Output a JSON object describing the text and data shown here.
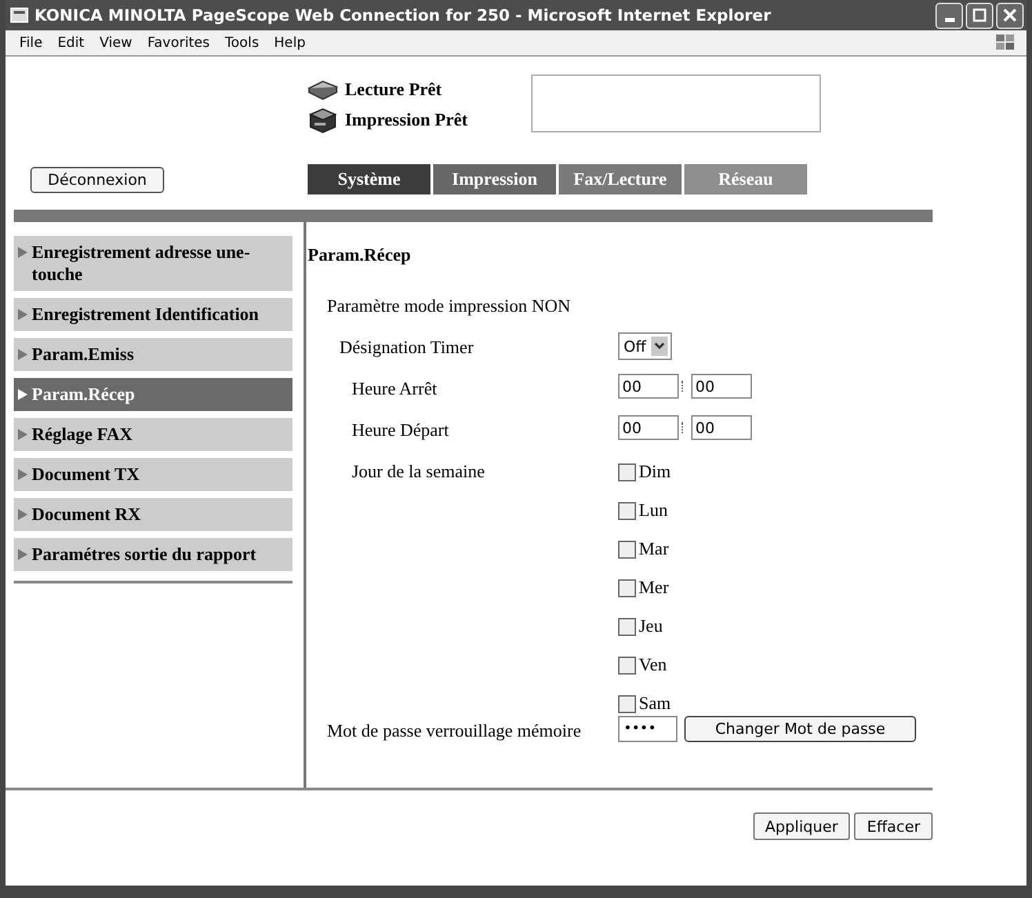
{
  "window": {
    "title": "KONICA MINOLTA PageScope Web Connection for 250 - Microsoft Internet Explorer"
  },
  "menu": [
    "File",
    "Edit",
    "View",
    "Favorites",
    "Tools",
    "Help"
  ],
  "status": [
    {
      "kind": "scanner",
      "label": "Lecture Prêt"
    },
    {
      "kind": "printer",
      "label": "Impression Prêt"
    }
  ],
  "logout_button": "Déconnexion",
  "tabs": [
    {
      "label": "Système",
      "selected": true
    },
    {
      "label": "Impression",
      "selected": false
    },
    {
      "label": "Fax/Lecture",
      "selected": false
    },
    {
      "label": "Réseau",
      "selected": false
    }
  ],
  "sidebar": {
    "items": [
      {
        "label": "Enregistrement adresse une-touche",
        "selected": false
      },
      {
        "label": "Enregistrement Identification",
        "selected": false
      },
      {
        "label": "Param.Emiss",
        "selected": false
      },
      {
        "label": "Param.Récep",
        "selected": true
      },
      {
        "label": "Réglage FAX",
        "selected": false
      },
      {
        "label": "Document TX",
        "selected": false
      },
      {
        "label": "Document RX",
        "selected": false
      },
      {
        "label": "Paramétres sortie du rapport",
        "selected": false
      }
    ]
  },
  "form": {
    "title": "Param.Récep",
    "rows": [
      {
        "kind": "heading",
        "label": "Paramètre mode impression NON",
        "children": [
          {
            "kind": "select",
            "label": "Désignation Timer",
            "value": "Off",
            "children": [
              {
                "kind": "time",
                "label": "Heure Arrêt",
                "hour": "00",
                "minute": "00"
              },
              {
                "kind": "time",
                "label": "Heure Départ",
                "hour": "00",
                "minute": "00"
              },
              {
                "kind": "days",
                "label": "Jour de la semaine",
                "days": [
                  {
                    "label": "Dim",
                    "checked": false
                  },
                  {
                    "label": "Lun",
                    "checked": false
                  },
                  {
                    "label": "Mar",
                    "checked": false
                  },
                  {
                    "label": "Mer",
                    "checked": false
                  },
                  {
                    "label": "Jeu",
                    "checked": false
                  },
                  {
                    "label": "Ven",
                    "checked": false
                  },
                  {
                    "label": "Sam",
                    "checked": false
                  }
                ]
              }
            ]
          }
        ]
      },
      {
        "kind": "password",
        "label": "Mot de passe verrouillage mémoire",
        "value": "••••",
        "button": "Changer Mot de passe"
      }
    ]
  },
  "buttons": [
    "Appliquer",
    "Effacer"
  ]
}
